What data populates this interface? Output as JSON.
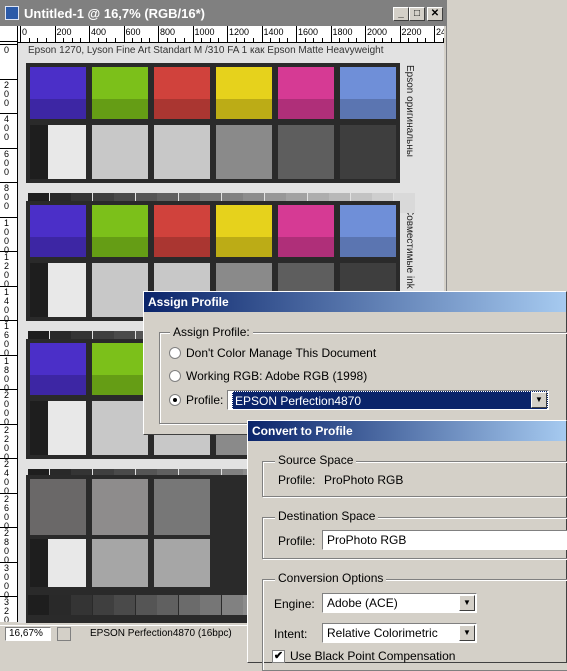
{
  "window": {
    "title": "Untitled-1 @ 16,7% (RGB/16*)",
    "buttons": [
      "_",
      "□",
      "✕"
    ],
    "ruler_top_labels": [
      "0",
      "200",
      "400",
      "600",
      "800",
      "1000",
      "1200",
      "1400",
      "1600",
      "1800",
      "2000",
      "2200",
      "2400"
    ],
    "ruler_left_labels": [
      "0",
      "2 0 0",
      "4 0 0",
      "6 0 0",
      "8 0 0",
      "1 0 0 0",
      "1 2 0 0",
      "1 4 0 0",
      "1 6 0 0",
      "1 8 0 0",
      "2 0 0 0",
      "2 2 0 0",
      "2 4 0 0",
      "2 6 0 0",
      "2 8 0 0",
      "3 0 0 0",
      "3 2 0 0",
      "3 4 0 0"
    ]
  },
  "document": {
    "header": "Epson 1270, Lyson Fine Art Standart M /310 FA 1 как Epson Matte Heavyweight",
    "side_text_1": "Epson оригинальны",
    "side_text_2": "Совместимые ink",
    "colors": {
      "blue": "#4b2fc8",
      "green": "#7cc01a",
      "red": "#d0423c",
      "yellow": "#e6d21c",
      "magenta": "#d63a94",
      "lightblue": "#6f8fd8",
      "dark": "#1e1e1e",
      "light": "#e8e8e8",
      "grey1": "#c8c8c8",
      "grey2": "#a6a6a6",
      "grey3": "#8a8a8a",
      "grey4": "#5e5e5e",
      "grey5": "#3e3e3e"
    }
  },
  "statusbar": {
    "zoom": "16,67%",
    "info": "EPSON Perfection4870 (16bpc)"
  },
  "assign_profile": {
    "title": "Assign Profile",
    "group_label": "Assign Profile:",
    "options": [
      {
        "label": "Don't Color Manage This Document",
        "selected": false
      },
      {
        "label": "Working RGB:  Adobe RGB (1998)",
        "selected": false
      },
      {
        "label": "Profile:",
        "selected": true
      }
    ],
    "profile_value": "EPSON Perfection4870"
  },
  "convert_profile": {
    "title": "Convert to Profile",
    "source": {
      "label": "Source Space",
      "profile_label": "Profile:",
      "profile_value": "ProPhoto RGB"
    },
    "destination": {
      "label": "Destination Space",
      "profile_label": "Profile:",
      "profile_value": "ProPhoto RGB"
    },
    "options": {
      "label": "Conversion Options",
      "engine_label": "Engine:",
      "engine_value": "Adobe (ACE)",
      "intent_label": "Intent:",
      "intent_value": "Relative Colorimetric",
      "bpc_label": "Use Black Point Compensation",
      "bpc_checked": true
    }
  }
}
